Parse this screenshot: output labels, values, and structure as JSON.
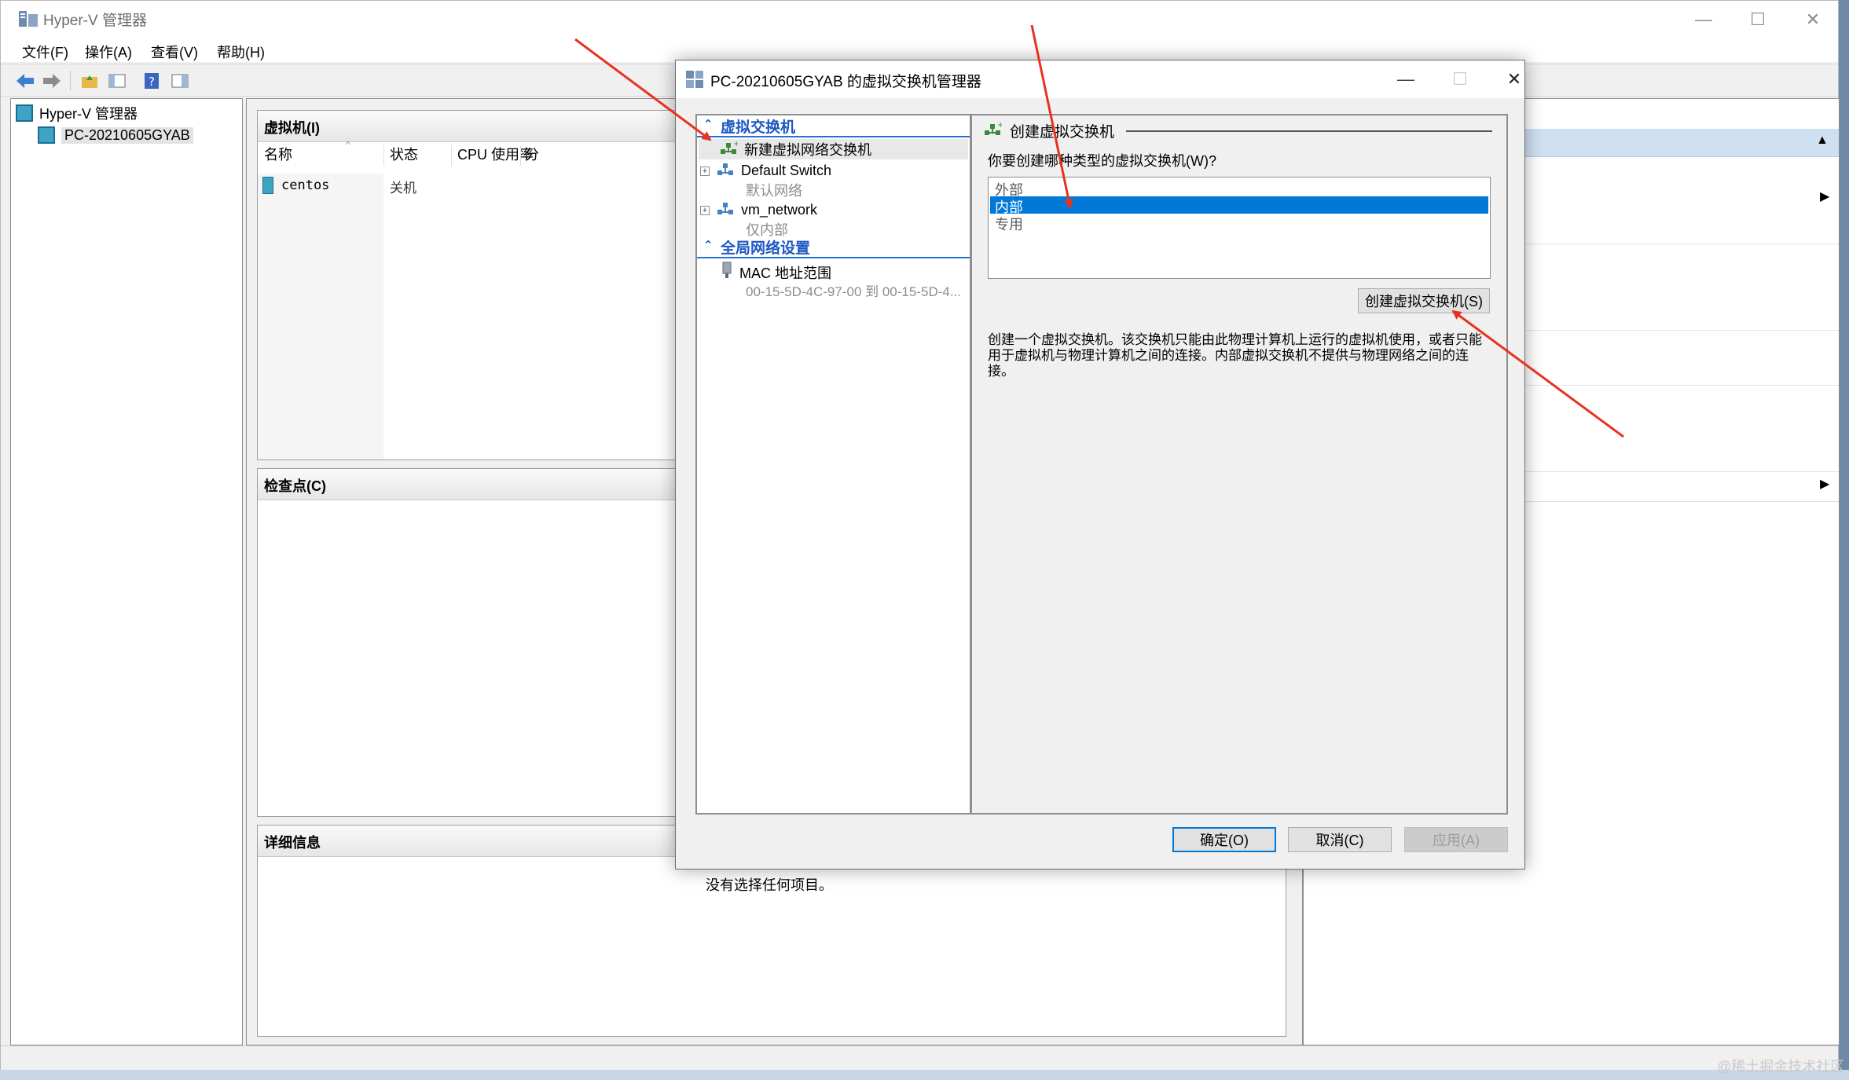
{
  "main_window": {
    "title": "Hyper-V 管理器",
    "menu": [
      "文件(F)",
      "操作(A)",
      "查看(V)",
      "帮助(H)"
    ],
    "tree": {
      "root": "Hyper-V 管理器",
      "server": "PC-20210605GYAB"
    },
    "vm_section": {
      "title": "虚拟机(I)",
      "columns": [
        "名称",
        "状态",
        "CPU 使用率",
        "分"
      ],
      "rows": [
        {
          "name": "centos",
          "state": "关机"
        }
      ]
    },
    "checkpoint_section": {
      "title": "检查点(C)"
    },
    "details_section": {
      "title": "详细信息",
      "empty_text": "没有选择任何项目。"
    }
  },
  "dialog": {
    "title": "PC-20210605GYAB 的虚拟交换机管理器",
    "tree": {
      "group1": "虚拟交换机",
      "new_switch": "新建虚拟网络交换机",
      "switches": [
        {
          "name": "Default Switch",
          "sub": "默认网络"
        },
        {
          "name": "vm_network",
          "sub": "仅内部"
        }
      ],
      "group2": "全局网络设置",
      "mac": {
        "name": "MAC 地址范围",
        "sub": "00-15-5D-4C-97-00 到 00-15-5D-4..."
      }
    },
    "panel": {
      "heading": "创建虚拟交换机",
      "question": "你要创建哪种类型的虚拟交换机(W)?",
      "options": [
        "外部",
        "内部",
        "专用"
      ],
      "selected_index": 1,
      "create_button": "创建虚拟交换机(S)",
      "description": "创建一个虚拟交换机。该交换机只能由此物理计算机上运行的虚拟机使用，或者只能用于虚拟机与物理计算机之间的连接。内部虚拟交换机不提供与物理网络之间的连接。"
    },
    "buttons": {
      "ok": "确定(O)",
      "cancel": "取消(C)",
      "apply": "应用(A)"
    }
  },
  "watermark": "@稀土掘金技术社区",
  "colors": {
    "selection": "#0078d7",
    "group_header": "#1c57c4",
    "annotation_arrow": "#e8321f"
  }
}
